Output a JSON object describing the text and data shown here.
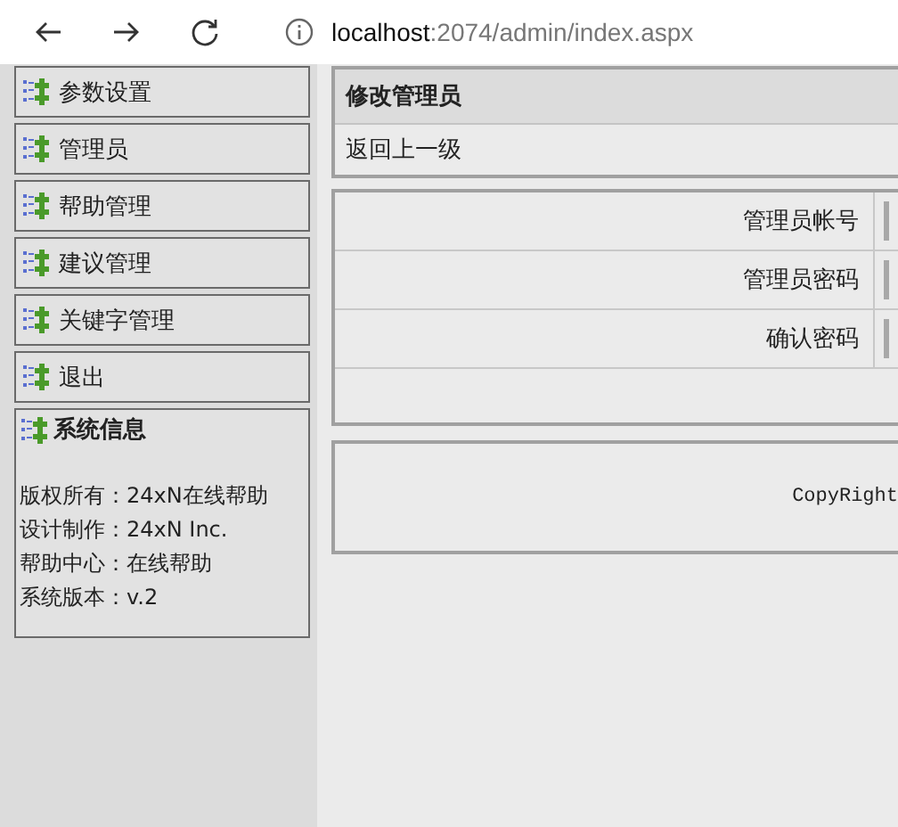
{
  "browser": {
    "url_host": "localhost",
    "url_path": ":2074/admin/index.aspx"
  },
  "sidebar": {
    "items": [
      {
        "label": "参数设置"
      },
      {
        "label": "管理员"
      },
      {
        "label": "帮助管理"
      },
      {
        "label": "建议管理"
      },
      {
        "label": "关键字管理"
      },
      {
        "label": "退出"
      }
    ],
    "info": {
      "title": "系统信息",
      "lines": [
        "版权所有：24xN在线帮助",
        "设计制作：24xN Inc.",
        "帮助中心：在线帮助",
        "系统版本：v.2"
      ]
    }
  },
  "main": {
    "title": "修改管理员",
    "back_link": "返回上一级",
    "fields": [
      {
        "label": "管理员帐号"
      },
      {
        "label": "管理员密码"
      },
      {
        "label": "确认密码"
      }
    ],
    "footer": "CopyRight"
  }
}
